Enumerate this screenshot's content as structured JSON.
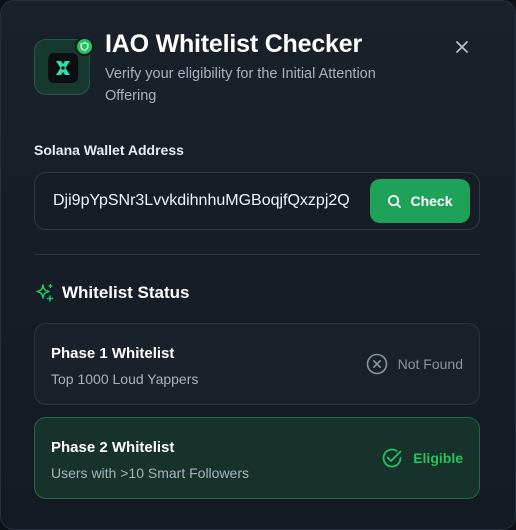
{
  "header": {
    "title": "IAO Whitelist Checker",
    "subtitle": "Verify your eligibility for the Initial Attention Offering",
    "logo_icon": "x-logo-icon",
    "badge_icon": "shield-check-icon",
    "close_icon": "close-icon"
  },
  "wallet": {
    "label": "Solana Wallet Address",
    "value": "Dji9pYpSNr3LvvkdihnhuMGBoqjfQxzpj2Q",
    "button_label": "Check",
    "button_icon": "search-icon"
  },
  "status_section": {
    "title": "Whitelist Status",
    "icon": "sparkles-icon",
    "phases": [
      {
        "title": "Phase 1 Whitelist",
        "description": "Top 1000 Loud Yappers",
        "status": "Not Found",
        "status_icon": "x-circle-icon"
      },
      {
        "title": "Phase 2 Whitelist",
        "description": "Users with >10 Smart Followers",
        "status": "Eligible",
        "status_icon": "check-circle-icon"
      }
    ]
  },
  "colors": {
    "accent": "#22c55e",
    "button": "#1ea25a",
    "background": "#141a22",
    "muted": "#8a94a1"
  }
}
